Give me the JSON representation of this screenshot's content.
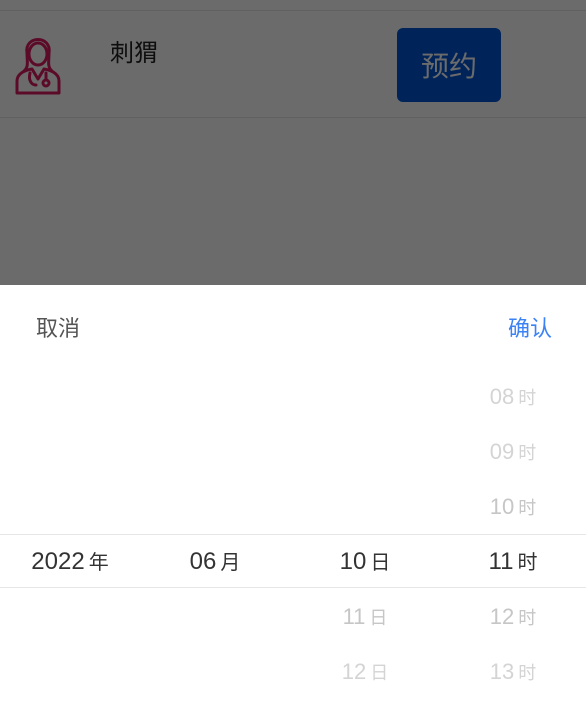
{
  "doctor": {
    "name": "刺猬",
    "book_label": "预约"
  },
  "picker": {
    "cancel_label": "取消",
    "confirm_label": "确认",
    "year": {
      "selected": "2022",
      "unit": "年"
    },
    "month": {
      "selected": "06",
      "unit": "月"
    },
    "day": {
      "selected": "10",
      "unit": "日",
      "below": [
        "11",
        "12"
      ]
    },
    "hour": {
      "selected": "11",
      "unit": "时",
      "above": [
        "08",
        "09",
        "10"
      ],
      "below": [
        "12",
        "13"
      ]
    }
  },
  "colors": {
    "accent": "#3b82f6",
    "button": "#0057d6",
    "avatar": "#d81b60"
  }
}
